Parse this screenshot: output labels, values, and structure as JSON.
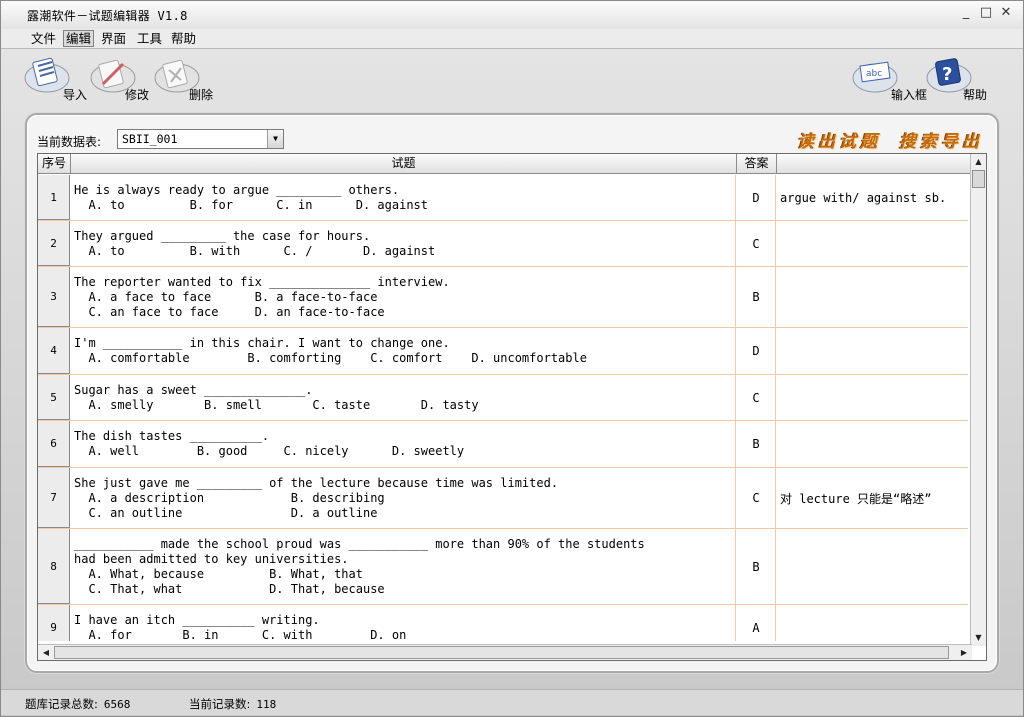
{
  "window": {
    "title": "露潮软件－试题编辑器 V1.8",
    "controls": {
      "minimize": "_",
      "maximize": "□",
      "close": "✕"
    }
  },
  "menu": [
    {
      "label": "文件",
      "active": false
    },
    {
      "label": "编辑",
      "active": true
    },
    {
      "label": "界面",
      "active": false
    },
    {
      "label": "工具",
      "active": false
    },
    {
      "label": "帮助",
      "active": false
    }
  ],
  "toolbar": {
    "import_label": "导入",
    "edit_label": "修改",
    "delete_label": "删除",
    "input_box_label": "输入框",
    "help_label": "帮助",
    "input_box_icon_text": "abc",
    "help_icon_text": "?"
  },
  "panel": {
    "dataset_label": "当前数据表:",
    "dataset_value": "SBII_001",
    "read_questions": "读出试题",
    "search_export": "搜索导出"
  },
  "grid": {
    "columns": {
      "num": "序号",
      "question": "试题",
      "answer": "答案",
      "note": ""
    },
    "rows": [
      {
        "num": "1",
        "lines": [
          "He is always ready to argue _________ others.",
          "  A. to         B. for      C. in      D. against"
        ],
        "answer": "D",
        "note": "argue with/ against sb."
      },
      {
        "num": "2",
        "lines": [
          "They argued _________ the case for hours.",
          "  A. to         B. with      C. /       D. against"
        ],
        "answer": "C",
        "note": ""
      },
      {
        "num": "3",
        "lines": [
          "The reporter wanted to fix ______________ interview.",
          "  A. a face to face      B. a face-to-face",
          "  C. an face to face     D. an face-to-face"
        ],
        "answer": "B",
        "note": ""
      },
      {
        "num": "4",
        "lines": [
          "I'm ___________ in this chair. I want to change one.",
          "  A. comfortable        B. comforting    C. comfort    D. uncomfortable"
        ],
        "answer": "D",
        "note": ""
      },
      {
        "num": "5",
        "lines": [
          "Sugar has a sweet ______________.",
          "  A. smelly       B. smell       C. taste       D. tasty"
        ],
        "answer": "C",
        "note": ""
      },
      {
        "num": "6",
        "lines": [
          "The dish tastes __________.",
          "  A. well        B. good     C. nicely      D. sweetly"
        ],
        "answer": "B",
        "note": ""
      },
      {
        "num": "7",
        "lines": [
          "She just gave me _________ of the lecture because time was limited.",
          "  A. a description            B. describing",
          "  C. an outline               D. a outline"
        ],
        "answer": "C",
        "note": "对 lecture 只能是“略述”"
      },
      {
        "num": "8",
        "lines": [
          "___________ made the school proud was ___________ more than 90% of the students",
          "had been admitted to key universities.",
          "  A. What, because         B. What, that",
          "  C. That, what            D. That, because"
        ],
        "answer": "B",
        "note": ""
      },
      {
        "num": "9",
        "lines": [
          "I have an itch __________ writing.",
          "  A. for       B. in      C. with        D. on"
        ],
        "answer": "A",
        "note": ""
      }
    ]
  },
  "status": {
    "total_label": "题库记录总数:",
    "total_value": "6568",
    "current_label": "当前记录数:",
    "current_value": "118"
  }
}
